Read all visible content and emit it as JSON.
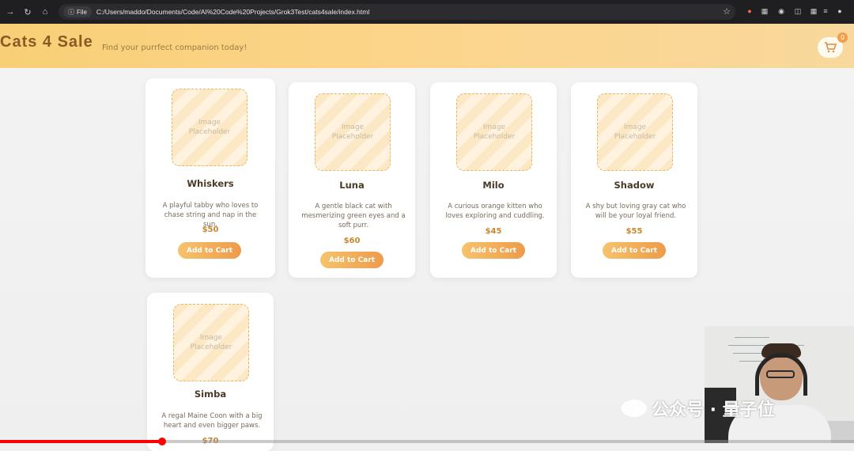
{
  "browser": {
    "file_chip_label": "File",
    "url": "C:/Users/maddo/Documents/Code/AI%20Code%20Projects/Grok3Test/cats4sale/index.html"
  },
  "header": {
    "brand": "Cats 4 Sale",
    "tagline": "Find your purrfect companion today!",
    "cart_count": "0"
  },
  "cards": [
    {
      "placeholder": "Image\nPlaceholder",
      "name": "Whiskers",
      "description": "A playful tabby who loves to chase string and nap in the sun.",
      "price": "$50",
      "button": "Add to Cart"
    },
    {
      "placeholder": "Image\nPlaceholder",
      "name": "Luna",
      "description": "A gentle black cat with mesmerizing green eyes and a soft purr.",
      "price": "$60",
      "button": "Add to Cart"
    },
    {
      "placeholder": "Image\nPlaceholder",
      "name": "Milo",
      "description": "A curious orange kitten who loves exploring and cuddling.",
      "price": "$45",
      "button": "Add to Cart"
    },
    {
      "placeholder": "Image\nPlaceholder",
      "name": "Shadow",
      "description": "A shy but loving gray cat who will be your loyal friend.",
      "price": "$55",
      "button": "Add to Cart"
    },
    {
      "placeholder": "Image\nPlaceholder",
      "name": "Simba",
      "description": "A regal Maine Coon with a big heart and even bigger paws.",
      "price": "$70",
      "button": "Add to Cart"
    }
  ],
  "watermark": {
    "text": "公众号 · 量子位"
  },
  "video_progress": 0.19,
  "colors": {
    "accent": "#ee9b4a",
    "header": "#f8cf76",
    "price": "#c9872f"
  }
}
